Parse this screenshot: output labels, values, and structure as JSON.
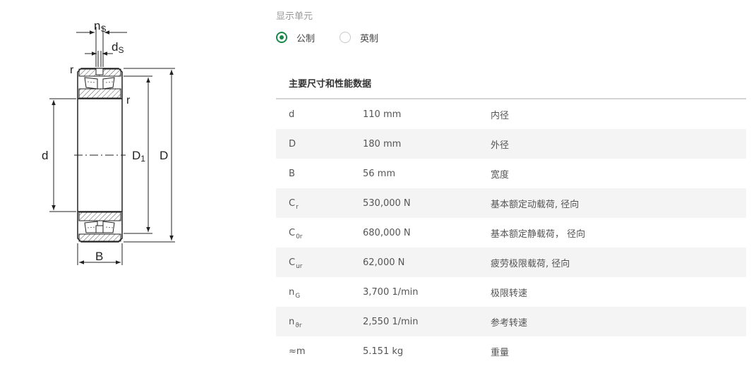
{
  "diagram": {
    "labels": {
      "ns_main": "n",
      "ns_sub": "S",
      "ds_main": "d",
      "ds_sub": "S",
      "r_top": "r",
      "r_right": "r",
      "d": "d",
      "d1_main": "D",
      "d1_sub": "1",
      "D": "D",
      "B": "B"
    }
  },
  "units": {
    "label": "显示单元",
    "options": [
      {
        "label": "公制",
        "selected": true
      },
      {
        "label": "英制",
        "selected": false
      }
    ]
  },
  "table": {
    "heading": "主要尺寸和性能数据",
    "rows": [
      {
        "sym": "d",
        "sub": "",
        "value": "110 mm",
        "desc": "内径"
      },
      {
        "sym": "D",
        "sub": "",
        "value": "180 mm",
        "desc": "外径"
      },
      {
        "sym": "B",
        "sub": "",
        "value": "56 mm",
        "desc": "宽度"
      },
      {
        "sym": "C",
        "sub": "r",
        "value": "530,000 N",
        "desc": "基本额定动载荷, 径向"
      },
      {
        "sym": "C",
        "sub": "0r",
        "value": "680,000 N",
        "desc": "基本额定静载荷， 径向"
      },
      {
        "sym": "C",
        "sub": "ur",
        "value": "62,000 N",
        "desc": "疲劳极限载荷, 径向"
      },
      {
        "sym": "n",
        "sub": "G",
        "value": "3,700 1/min",
        "desc": "极限转速"
      },
      {
        "sym": "n",
        "sub": "ϑr",
        "value": "2,550 1/min",
        "desc": "参考转速"
      },
      {
        "sym": "≈m",
        "sub": "",
        "value": "5.151 kg",
        "desc": "重量"
      }
    ]
  },
  "colors": {
    "accent": "#18874a",
    "row_alt": "#f4f4f5",
    "rule": "#d4d4d4"
  }
}
